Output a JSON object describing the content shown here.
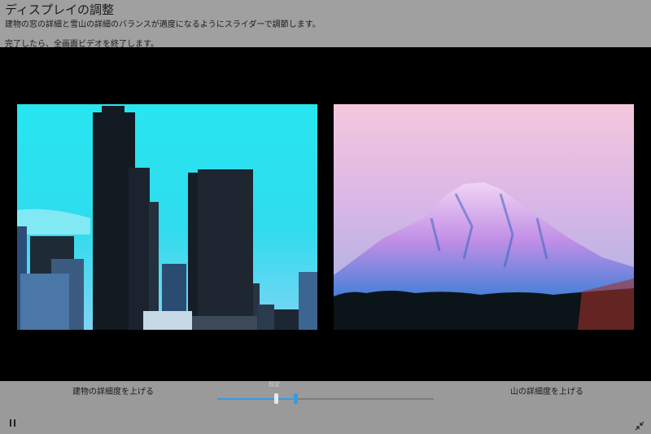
{
  "header": {
    "title": "ディスプレイの調整",
    "description": "建物の窓の詳細と雪山の詳細のバランスが適度になるようにスライダーで調節します。",
    "instruction": "完了したら、全画面ビデオを終了します。"
  },
  "controls": {
    "left_label": "建物の詳細度を上げる",
    "right_label": "山の詳細度を上げる",
    "default_label": "既定",
    "slider_value_fraction": 0.36,
    "default_marker_fraction": 0.27,
    "accent_color": "#3a9ae0"
  },
  "icons": {
    "pause": "pause-icon",
    "exit_fullscreen": "exit-fullscreen-icon"
  }
}
